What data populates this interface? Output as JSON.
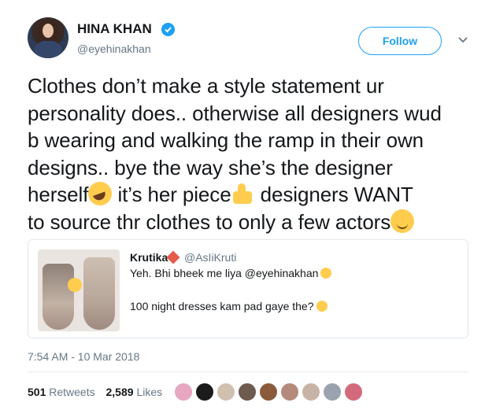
{
  "user": {
    "name": "HINA KHAN",
    "handle": "@eyehinakhan",
    "avatar_icon": "profile-avatar",
    "verified_icon": "verified-badge-icon",
    "verified_color": "#1da1f2"
  },
  "follow_label": "Follow",
  "tweet": {
    "line1": "Clothes don’t make a style statement ur",
    "line2": "personality does.. otherwise all designers wud",
    "line3": "b wearing and walking the ramp in their own",
    "line4": "designs.. bye the way she’s the designer",
    "line5a": "herself",
    "line5b": " it’s her piece",
    "line5c": " designers WANT",
    "line6": "to source thr clothes to only a few actors",
    "emojis": [
      "rofl-emoji",
      "thumbs-up-emoji",
      "wink-emoji"
    ]
  },
  "quoted": {
    "name": "Krutika",
    "handle": "@AsIiKruti",
    "line1": "Yeh. Bhi bheek me liya @eyehinakhan",
    "line2": "100 night dresses kam pad gaye the?"
  },
  "timestamp": "7:54 AM - 10 Mar 2018",
  "stats": {
    "retweets_count": "501",
    "retweets_label": "Retweets",
    "likes_count": "2,589",
    "likes_label": "Likes"
  },
  "colors": {
    "accent": "#1da1f2",
    "text": "#14171a",
    "secondary": "#657786",
    "border": "#e1e8ed"
  },
  "likers": [
    {
      "color": "#e7a7c0"
    },
    {
      "color": "#1b1b1b"
    },
    {
      "color": "#cfc0b0"
    },
    {
      "color": "#6e5a4f"
    },
    {
      "color": "#8a5a3c"
    },
    {
      "color": "#b48a7a"
    },
    {
      "color": "#c9b2a6"
    },
    {
      "color": "#9aa3ad"
    },
    {
      "color": "#d36a7c"
    }
  ]
}
